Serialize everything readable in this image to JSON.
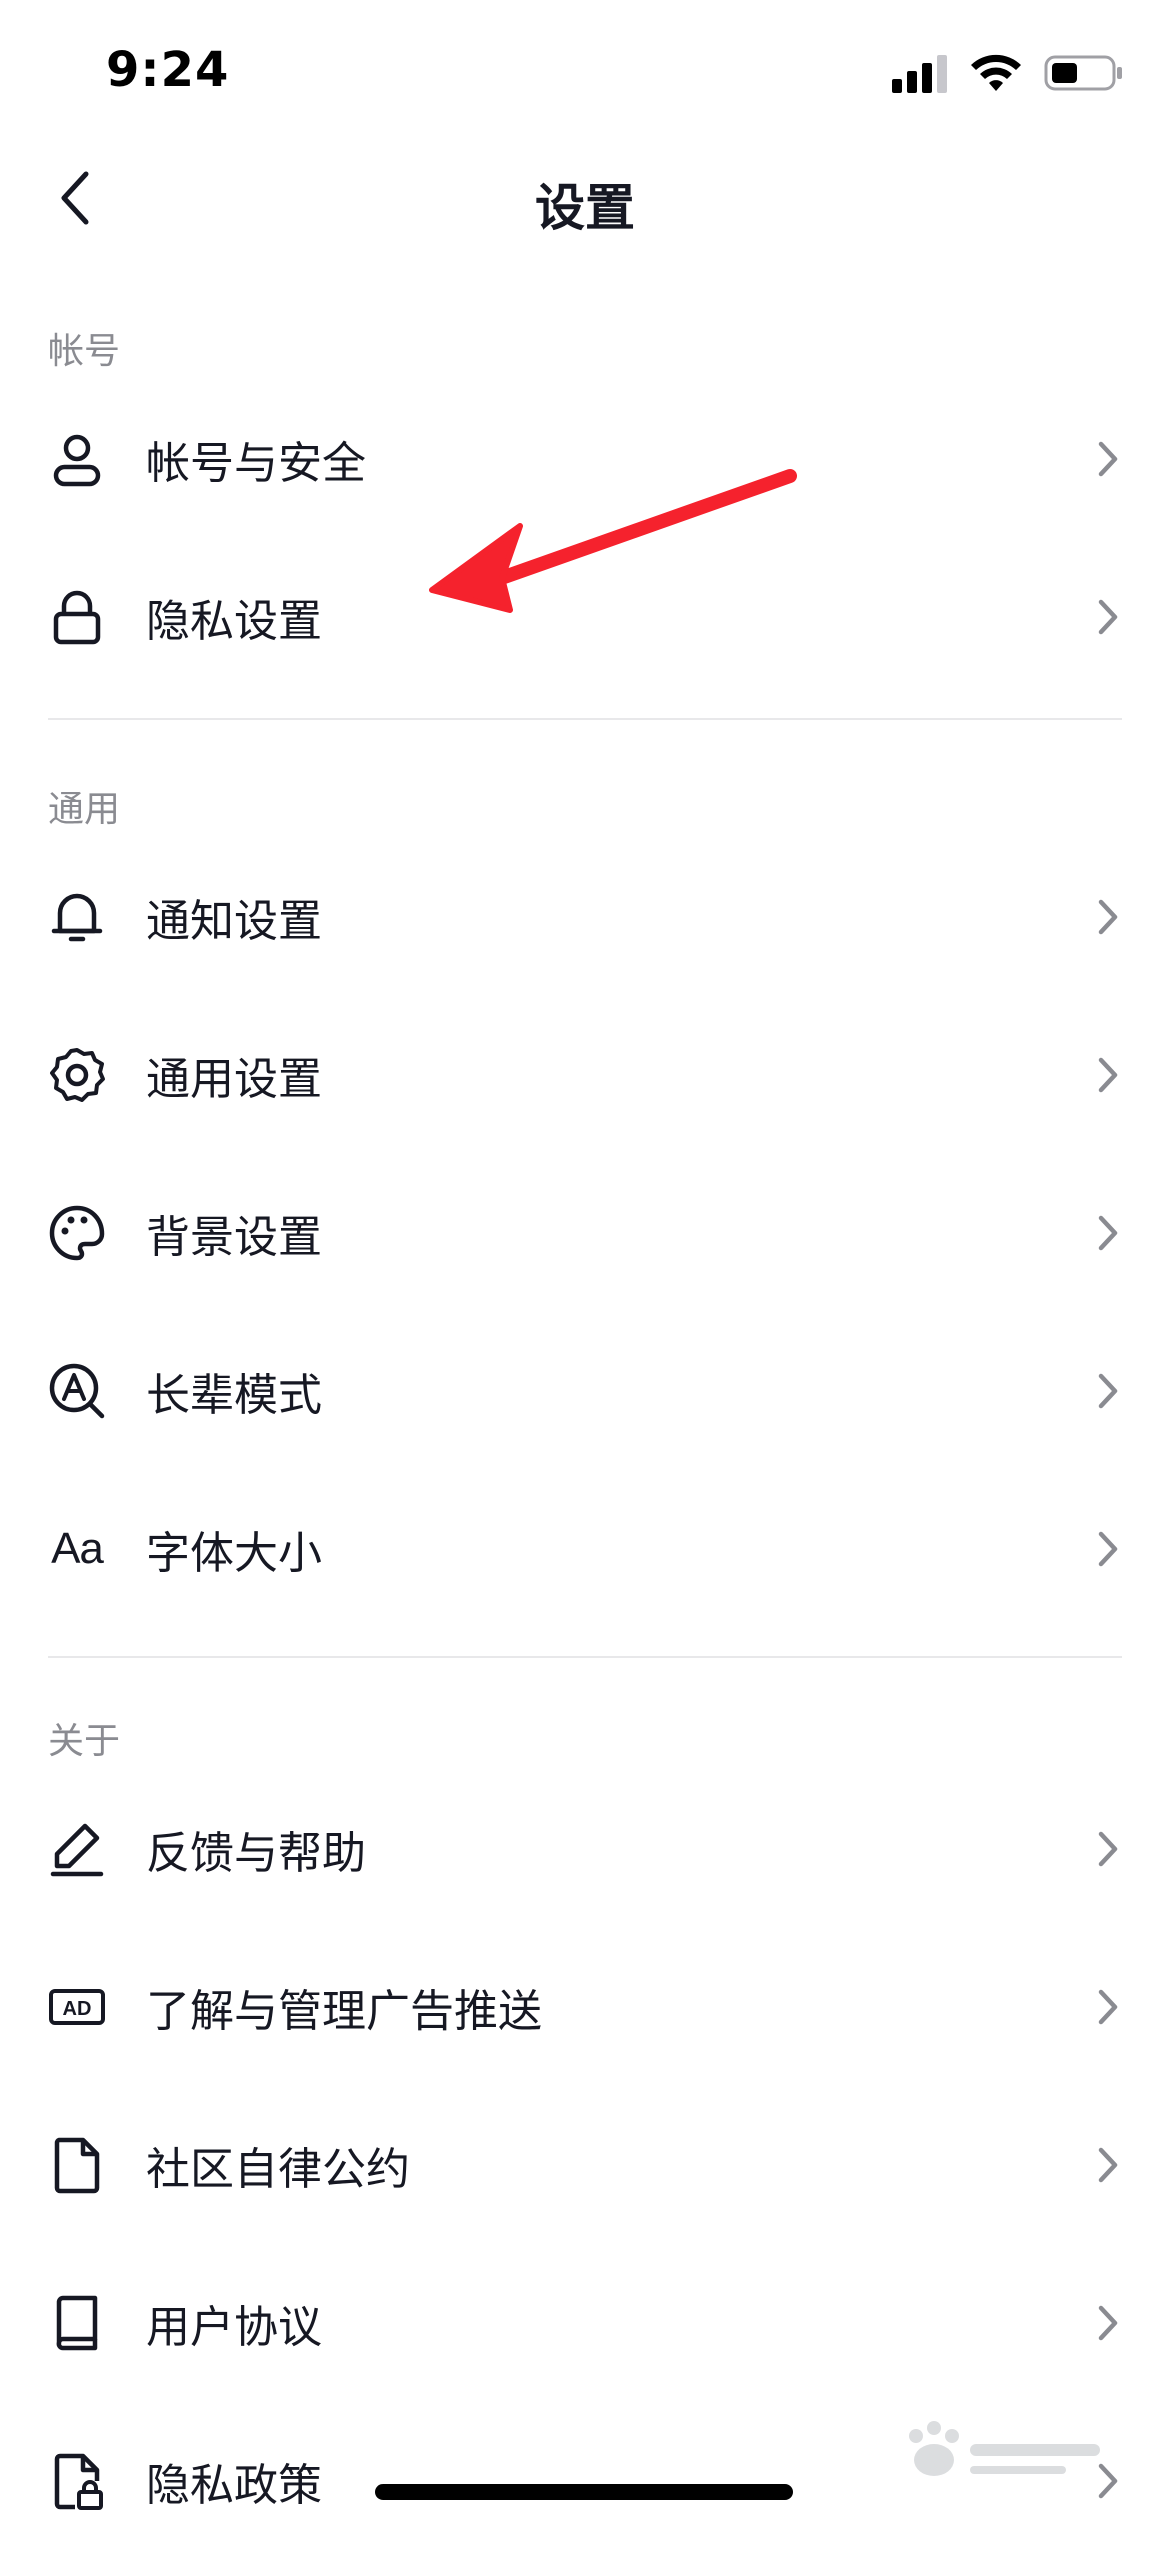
{
  "status_bar": {
    "time": "9:24",
    "signal_icon": "cellular-signal-icon",
    "wifi_icon": "wifi-icon",
    "battery_icon": "battery-icon",
    "battery_level": 0.45
  },
  "nav": {
    "title": "设置",
    "back_icon": "chevron-left-icon"
  },
  "sections": [
    {
      "header": "帐号",
      "items": [
        {
          "label": "帐号与安全",
          "icon": "user-icon"
        },
        {
          "label": "隐私设置",
          "icon": "lock-icon"
        }
      ]
    },
    {
      "header": "通用",
      "items": [
        {
          "label": "通知设置",
          "icon": "bell-icon"
        },
        {
          "label": "通用设置",
          "icon": "gear-icon"
        },
        {
          "label": "背景设置",
          "icon": "palette-icon"
        },
        {
          "label": "长辈模式",
          "icon": "elder-mode-icon"
        },
        {
          "label": "字体大小",
          "icon": "font-size-icon",
          "icon_text": "Aa"
        }
      ]
    },
    {
      "header": "关于",
      "items": [
        {
          "label": "反馈与帮助",
          "icon": "pencil-icon"
        },
        {
          "label": "了解与管理广告推送",
          "icon": "ad-icon",
          "icon_text": "AD"
        },
        {
          "label": "社区自律公约",
          "icon": "document-icon"
        },
        {
          "label": "用户协议",
          "icon": "book-icon"
        },
        {
          "label": "隐私政策",
          "icon": "document-lock-icon"
        }
      ]
    }
  ],
  "annotation": {
    "type": "arrow",
    "color": "#f5222d",
    "points_to": "隐私设置"
  },
  "watermark": {
    "icon": "baidu-watermark-icon"
  },
  "colors": {
    "text_primary": "#161823",
    "text_secondary": "#8a8b91",
    "chevron": "#8a8b91",
    "divider": "#e8e8ea",
    "background": "#ffffff"
  }
}
